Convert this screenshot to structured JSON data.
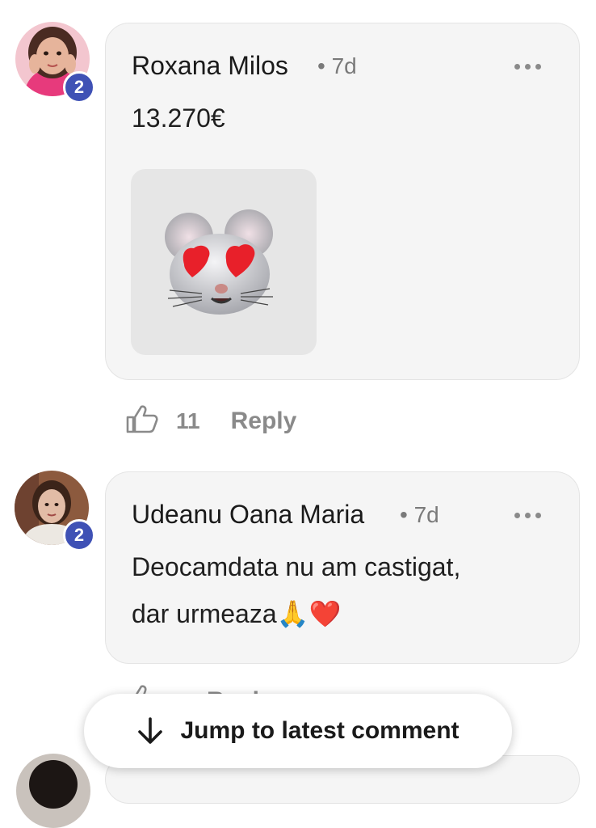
{
  "comments": [
    {
      "author": "Roxana Milos",
      "time": "7d",
      "badge": "2",
      "text_lines": [
        "13.270€"
      ],
      "likes": "11",
      "reply_label": "Reply",
      "sticker": "mouse-heart-eyes-sticker"
    },
    {
      "author": "Udeanu Oana Maria",
      "time": "7d",
      "badge": "2",
      "text_lines": [
        "Deocamdata nu am castigat,",
        "dar urmeaza🙏❤️"
      ],
      "likes": "",
      "reply_label": "Reply"
    }
  ],
  "jump_button": {
    "label": "Jump to latest comment",
    "icon": "arrow-down-icon"
  },
  "colors": {
    "badge": "#3f51b5",
    "bubble": "#f5f5f5",
    "muted": "#8a8a8a"
  }
}
